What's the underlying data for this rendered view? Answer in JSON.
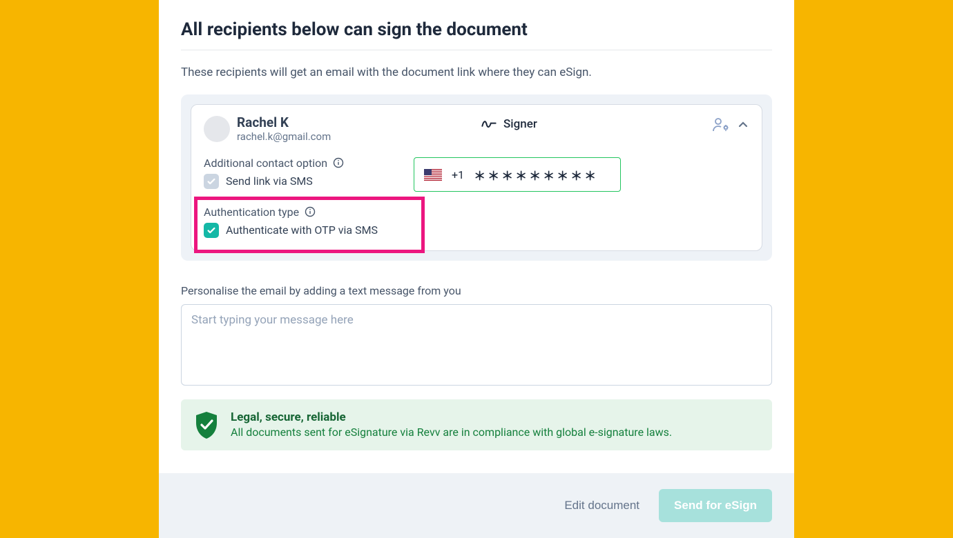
{
  "page": {
    "title": "All recipients below can sign the document",
    "subtitle": "These recipients will get an email with the document link where they can eSign."
  },
  "recipient": {
    "name": "Rachel K",
    "email": "rachel.k@gmail.com",
    "role": "Signer",
    "additional_contact_label": "Additional contact option",
    "sms_link_label": "Send link via SMS",
    "sms_link_checked": false,
    "auth_type_label": "Authentication type",
    "auth_sms_label": "Authenticate with OTP via SMS",
    "auth_sms_checked": true,
    "phone": {
      "country": "US",
      "dial_code": "+1",
      "masked": "＊＊＊＊＊＊＊＊＊"
    }
  },
  "personalise": {
    "label": "Personalise the email by adding a text message from you",
    "placeholder": "Start typing your message here",
    "value": ""
  },
  "legal": {
    "title": "Legal, secure, reliable",
    "desc": "All documents sent for eSignature via Revv are in compliance with global e-signature laws."
  },
  "footer": {
    "edit": "Edit document",
    "send": "Send for eSign"
  }
}
